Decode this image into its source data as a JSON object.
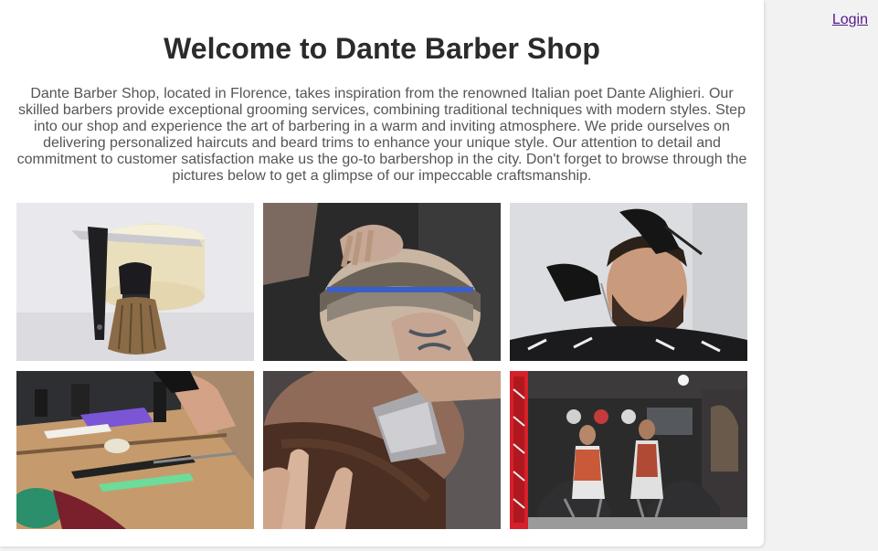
{
  "header": {
    "login_label": "Login"
  },
  "main": {
    "title": "Welcome to Dante Barber Shop",
    "intro": "Dante Barber Shop, located in Florence, takes inspiration from the renowned Italian poet Dante Alighieri. Our skilled barbers provide exceptional grooming services, combining traditional techniques with modern styles. Step into our shop and experience the art of barbering in a warm and inviting atmosphere. We pride ourselves on delivering personalized haircuts and beard trims to enhance your unique style. Our attention to detail and commitment to customer satisfaction make us the go-to barbershop in the city. Don't forget to browse through the pictures below to get a glimpse of our impeccable craftsmanship."
  },
  "gallery": {
    "photos": [
      {
        "subject": "straight razor and shaving brush"
      },
      {
        "subject": "barber combing a client's fade haircut"
      },
      {
        "subject": "barber trimming a client's beard"
      },
      {
        "subject": "barber tools on a wooden shelf"
      },
      {
        "subject": "razor shaving a beard"
      },
      {
        "subject": "barbershop interior with barbers and clients"
      }
    ]
  },
  "colors": {
    "background": "#f2f2f2",
    "card": "#ffffff",
    "title": "#2b2b2b",
    "text": "#555555",
    "link": "#551a8b"
  }
}
